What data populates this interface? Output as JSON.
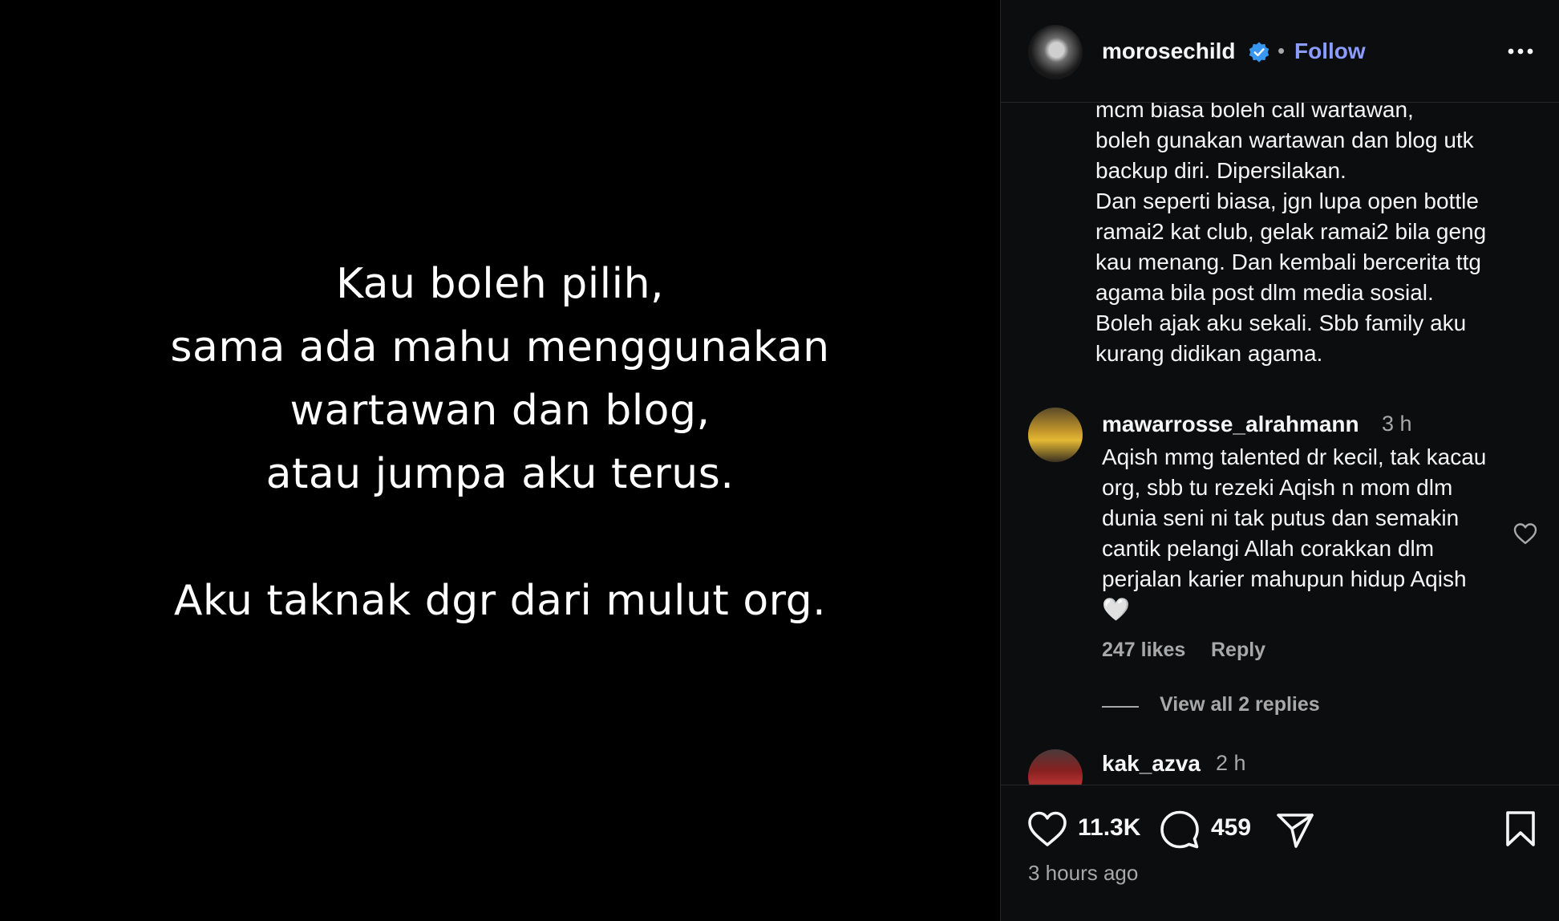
{
  "post": {
    "quote_lines": [
      "Kau boleh pilih,",
      "sama ada mahu menggunakan",
      "wartawan dan blog,",
      "atau jumpa aku terus."
    ],
    "quote_last": "Aku taknak dgr dari mulut org."
  },
  "header": {
    "username": "morosechild",
    "separator": "•",
    "follow_label": "Follow",
    "verified_color": "#3897f0"
  },
  "caption": {
    "text": "mcm biasa boleh call wartawan,\nboleh gunakan wartawan dan blog utk\nbackup diri. Dipersilakan.\nDan seperti biasa, jgn lupa open bottle\nramai2 kat club, gelak ramai2 bila geng\nkau menang.  Dan kembali bercerita ttg\nagama bila post dlm media sosial.\nBoleh ajak aku sekali. Sbb family aku\nkurang didikan agama."
  },
  "comments": [
    {
      "username": "mawarrosse_alrahmann",
      "time": "3 h",
      "text": "Aqish mmg talented dr kecil, tak kacau org, sbb tu rezeki Aqish n mom dlm dunia seni ni tak putus dan semakin cantik pelangi Allah corakkan dlm perjalan karier mahupun hidup Aqish🤍",
      "likes": "247 likes",
      "reply_label": "Reply",
      "view_replies": "View all 2 replies"
    },
    {
      "username": "kak_azva",
      "time": "2 h"
    }
  ],
  "actions": {
    "like_count": "11.3K",
    "comment_count": "459",
    "timestamp": "3 hours ago"
  },
  "colors": {
    "background": "#000000",
    "panel": "#0c0d0f",
    "link": "#8c9bff",
    "muted": "#a8a8a8"
  }
}
